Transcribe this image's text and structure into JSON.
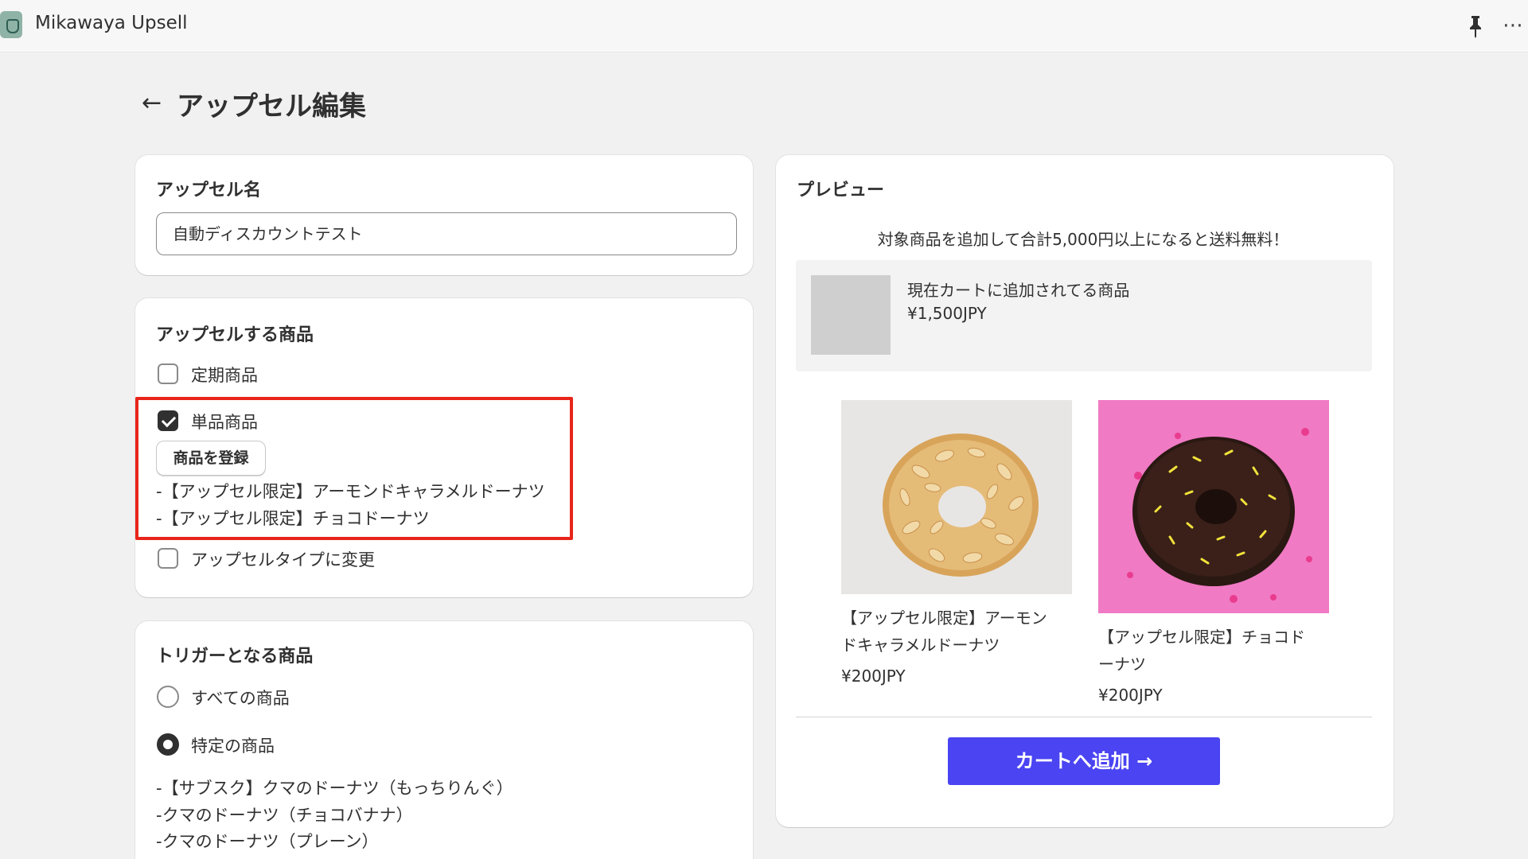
{
  "app": {
    "title": "Mikawaya Upsell"
  },
  "header": {
    "title": "アップセル編集",
    "back_label": "←"
  },
  "topbar": {
    "more_label": "⋯"
  },
  "upsell_name": {
    "title": "アップセル名",
    "value": "自動ディスカウントテスト"
  },
  "products": {
    "title": "アップセルする商品",
    "subscription": {
      "label": "定期商品",
      "checked": false
    },
    "single": {
      "label": "単品商品",
      "checked": true
    },
    "register_label": "商品を登録",
    "items": [
      "-【アップセル限定】アーモンドキャラメルドーナツ",
      "-【アップセル限定】チョコドーナツ"
    ],
    "change_type": {
      "label": "アップセルタイプに変更",
      "checked": false
    }
  },
  "trigger": {
    "title": "トリガーとなる商品",
    "all": {
      "label": "すべての商品",
      "selected": false
    },
    "specific": {
      "label": "特定の商品",
      "selected": true
    },
    "items": [
      "-【サブスク】クマのドーナツ（もっちりんぐ）",
      "-クマのドーナツ（チョコバナナ）",
      "-クマのドーナツ（プレーン）"
    ]
  },
  "preview": {
    "title": "プレビュー",
    "message": "対象商品を追加して合計5,000円以上になると送料無料！",
    "cart_item": {
      "name": "現在カートに追加されてる商品",
      "price": "¥1,500JPY"
    },
    "products": [
      {
        "name_line1": "【アップセル限定】アーモン",
        "name_line2": "ドキャラメルドーナツ",
        "price": "¥200JPY"
      },
      {
        "name_line1": "【アップセル限定】チョコド",
        "name_line2": "ーナツ",
        "price": "¥200JPY"
      }
    ],
    "button_label": "カートへ追加 →"
  },
  "colors": {
    "accent": "#4a44f2",
    "highlight": "#e8251a",
    "background": "#f1f1f1"
  }
}
